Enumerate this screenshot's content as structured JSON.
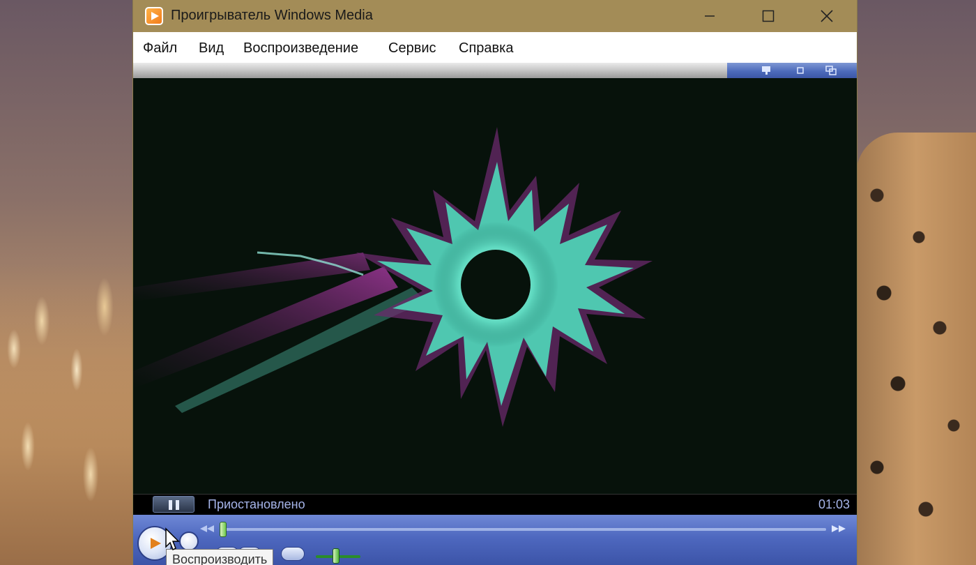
{
  "window": {
    "title": "Проигрыватель Windows Media",
    "icon": "windows-media-player-icon",
    "controls": [
      "minimize-icon",
      "maximize-icon",
      "close-icon"
    ]
  },
  "menu": {
    "items": [
      "Файл",
      "Вид",
      "Воспроизведение",
      "Сервис",
      "Справка"
    ]
  },
  "status": {
    "state": "Приостановлено",
    "time": "01:03"
  },
  "transport": {
    "play_tooltip": "Воспроизводить"
  },
  "colors": {
    "titlebar": "#a38c57",
    "controls_bar": "#4e68bf",
    "status_text": "#a6b5ea",
    "video_bg": "#07120b",
    "visualization_glow": "#5fd9c0",
    "visualization_trail": "#7a2a78"
  }
}
